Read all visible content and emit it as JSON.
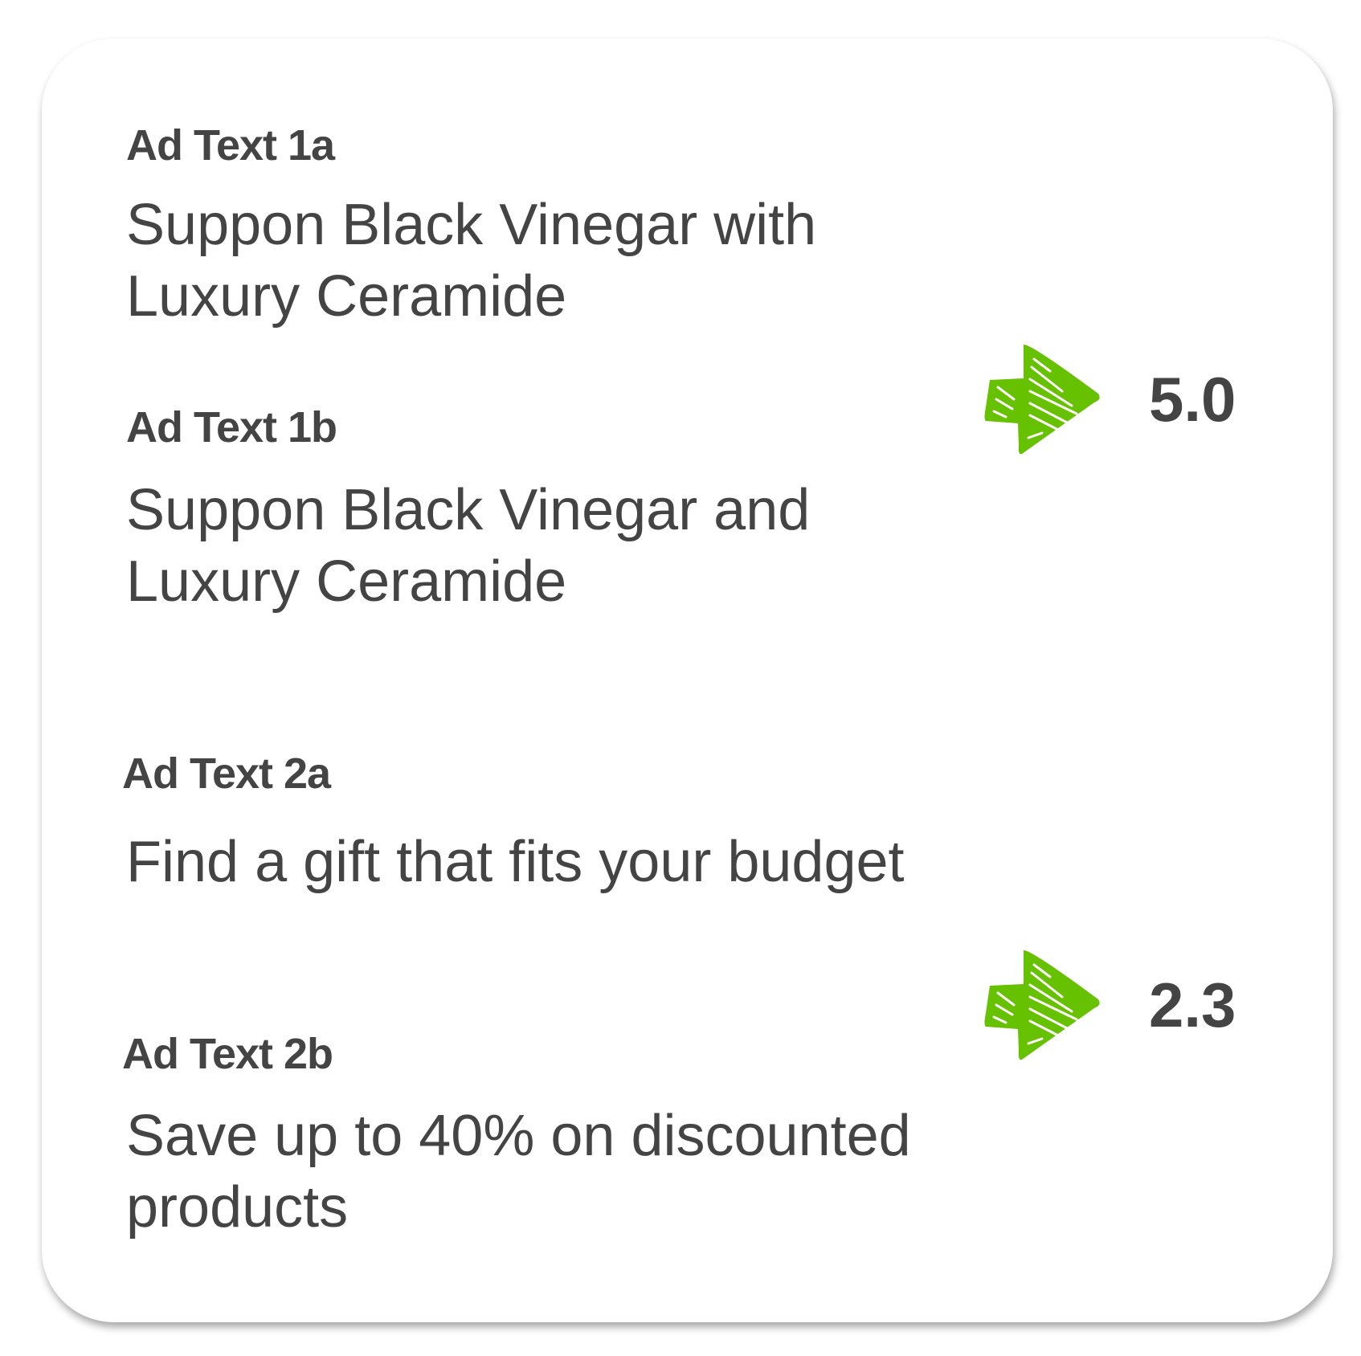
{
  "groups": [
    {
      "label_a": "Ad Text 1a",
      "text_a": "Suppon Black Vinegar with Luxury Ceramide",
      "label_b": "Ad Text 1b",
      "text_b": "Suppon Black Vinegar and Luxury Ceramide",
      "score": "5.0"
    },
    {
      "label_a": "Ad Text 2a",
      "text_a": "Find a gift that fits your budget",
      "label_b": "Ad Text 2b",
      "text_b": "Save up to 40% on discounted products",
      "score": "2.3"
    }
  ],
  "colors": {
    "arrow": "#66c100",
    "text": "#444444"
  },
  "icons": {
    "arrow": "sketch-arrow-right-icon"
  }
}
